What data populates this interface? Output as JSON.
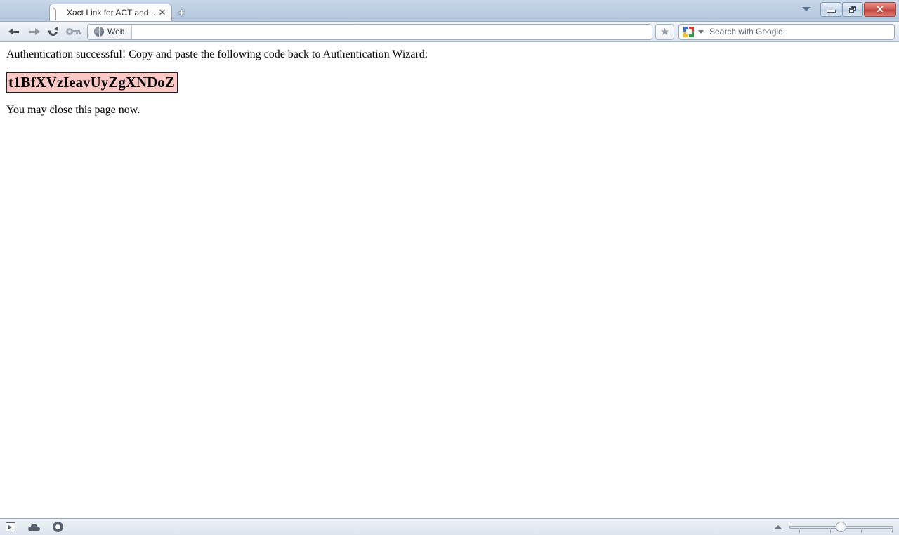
{
  "window": {
    "tab_list_icon": "chevron-down-icon",
    "minimize_label": "",
    "maximize_label": "",
    "close_label": "✕"
  },
  "tabs": [
    {
      "title": "Xact Link for ACT and ...",
      "favicon": "page-icon",
      "close_label": "✕"
    }
  ],
  "newtab": {
    "label": "+"
  },
  "toolbar": {
    "back_icon": "back-arrow-icon",
    "forward_icon": "forward-arrow-icon",
    "reload_icon": "reload-icon",
    "security_icon": "key-icon",
    "scope_label": "Web",
    "scope_icon": "globe-icon",
    "url_value": "",
    "url_placeholder": "",
    "bookmark_icon": "star-icon",
    "bookmark_glyph": "★"
  },
  "search": {
    "engine_icon": "google-icon",
    "placeholder": "Search with Google",
    "value": ""
  },
  "page": {
    "line1": "Authentication successful! Copy and paste the following code back to Authentication Wizard:",
    "code": "t1BfXVzIeavUyZgXNDoZ",
    "line3": "You may close this page now."
  },
  "statusbar": {
    "icons": [
      {
        "name": "panel-toggle-icon"
      },
      {
        "name": "cloud-icon"
      },
      {
        "name": "gauge-icon"
      }
    ],
    "zoom_expand_icon": "triangle-up-icon",
    "zoom_value": "100"
  },
  "colors": {
    "titlebar": "#bccde1",
    "code_highlight": "#fac9c5",
    "close_button": "#c0453d",
    "accent_blue": "#3b6fd4"
  }
}
